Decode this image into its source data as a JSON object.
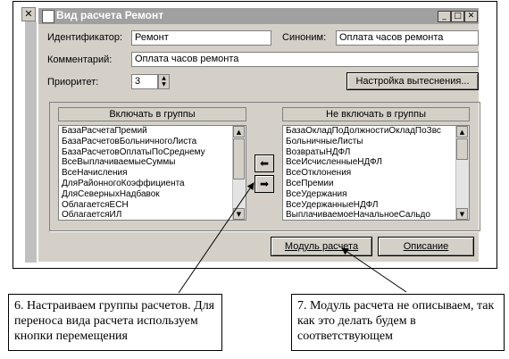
{
  "window": {
    "title": "Вид расчета Ремонт",
    "minimize_glyph": "_",
    "maximize_glyph": "□",
    "close_glyph": "✕",
    "background_close_glyph": "✕"
  },
  "form": {
    "identifier_label": "Идентификатор:",
    "identifier_value": "Ремонт",
    "synonym_label": "Синоним:",
    "synonym_value": "Оплата часов ремонта",
    "comment_label": "Комментарий:",
    "comment_value": "Оплата часов ремонта",
    "priority_label": "Приоритет:",
    "priority_value": "3",
    "displacement_button": "Настройка вытеснения..."
  },
  "include_groups": {
    "header": "Включать в группы",
    "items": [
      "БазаРасчетаПремий",
      "БазаРасчетовБольничногоЛиста",
      "БазаРасчетовОплатыПоСреднему",
      "ВсеВыплачиваемыеСуммы",
      "ВсеНачисления",
      "ДляРайонногоКоэффициента",
      "ДляСеверныхНадбавок",
      "ОблагаетсяЕСН",
      "ОблагаетсяИЛ"
    ]
  },
  "exclude_groups": {
    "header": "Не включать в группы",
    "items": [
      "БазаОкладПоДолжностиОкладПоЗвс",
      "БольничныеЛисты",
      "ВозвратыНДФЛ",
      "ВсеИсчисленныеНДФЛ",
      "ВсеОтклонения",
      "ВсеПремии",
      "ВсеУдержания",
      "ВсеУдержанныеНДФЛ",
      "ВыплачиваемоеНачальноеСальдо"
    ]
  },
  "move_buttons": {
    "to_include": "⬅",
    "to_exclude": "➡"
  },
  "buttons": {
    "module": "Модуль расчета",
    "description": "Описание"
  },
  "notes": {
    "left": "6. Настраиваем группы расчетов. Для переноса вида расчета используем кнопки перемещения",
    "right": "7. Модуль  расчета не описываем, так как это делать будем в соответствующем"
  }
}
